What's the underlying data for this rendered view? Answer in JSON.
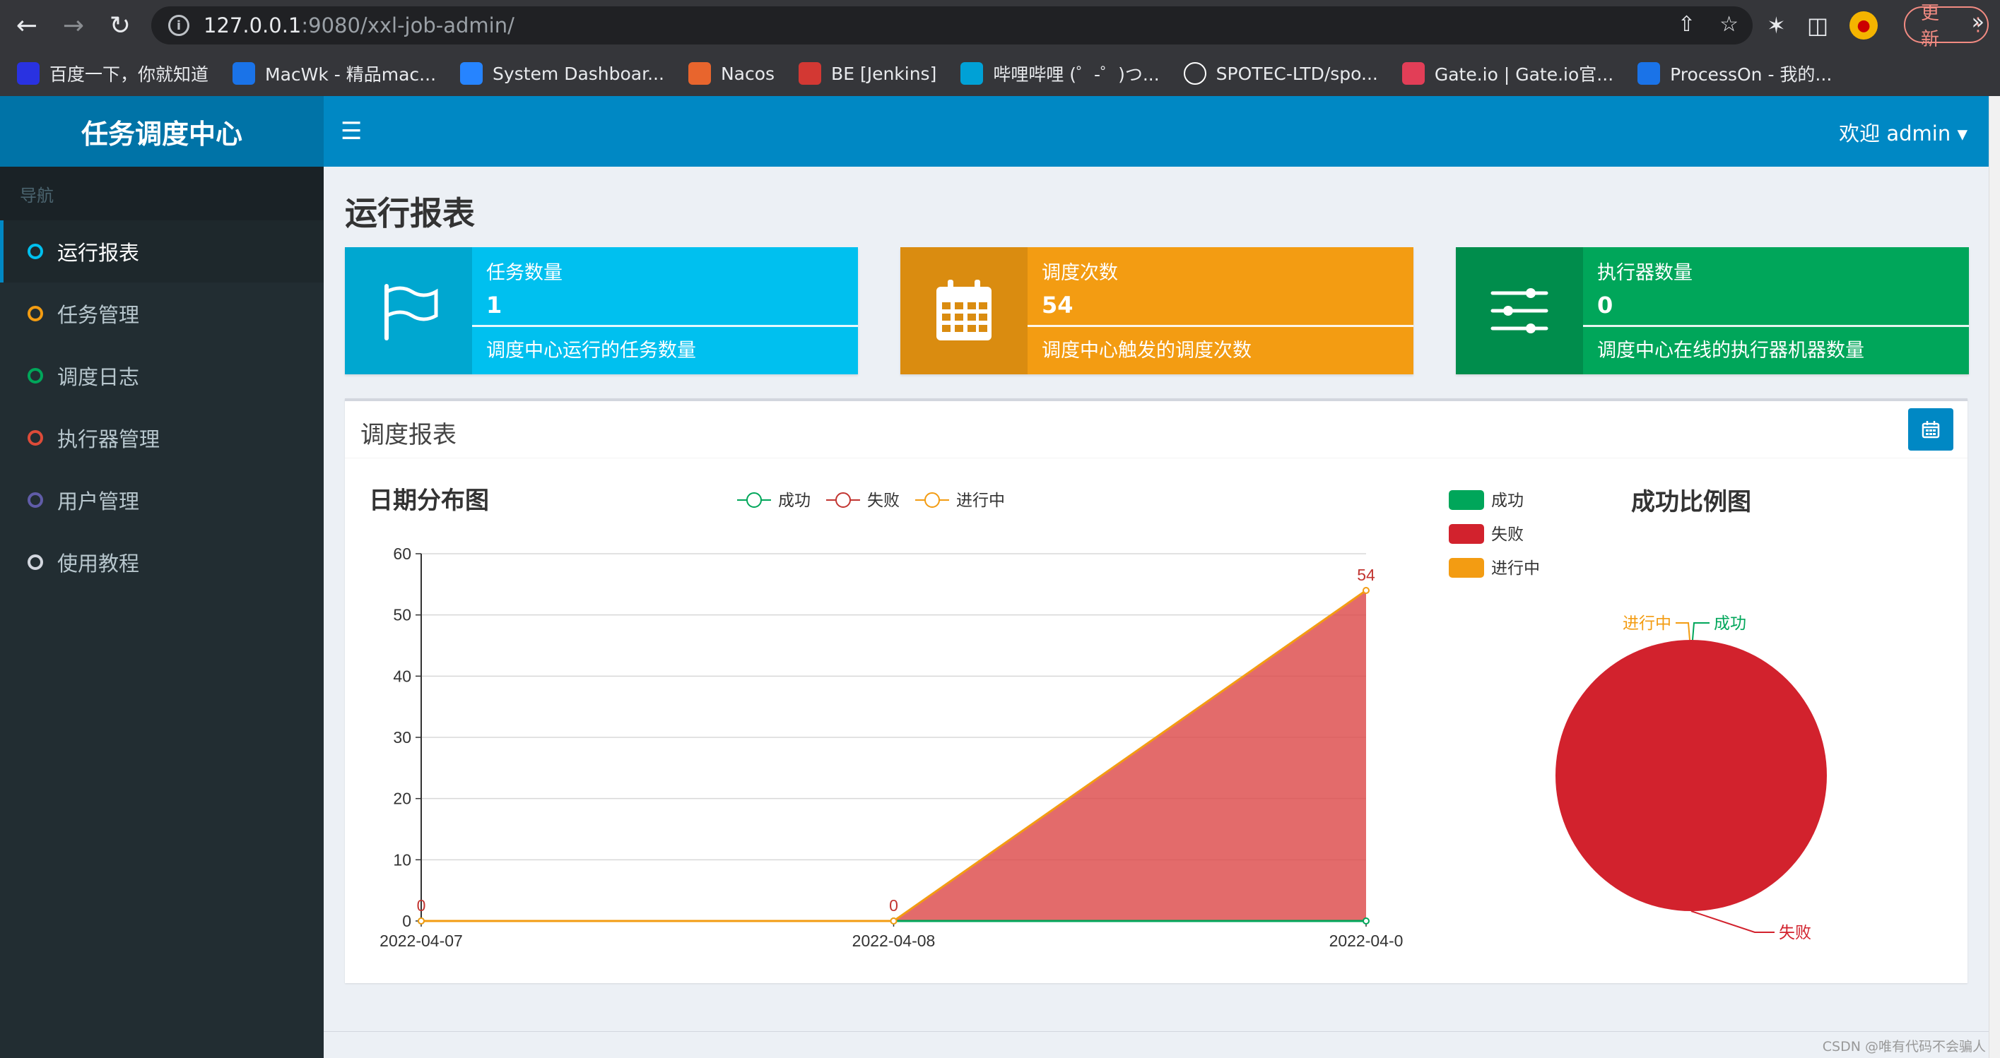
{
  "browser": {
    "url_host": "127.0.0.1",
    "url_path": ":9080/xxl-job-admin/",
    "update_label": "更新",
    "bookmarks": [
      {
        "label": "百度一下，你就知道",
        "icon": "baidu-icon",
        "color": "#2932e1"
      },
      {
        "label": "MacWk - 精品mac...",
        "icon": "macwk-icon",
        "color": "#1a73e8"
      },
      {
        "label": "System Dashboar...",
        "icon": "jira-icon",
        "color": "#2684ff"
      },
      {
        "label": "Nacos",
        "icon": "nacos-icon",
        "color": "#e8652d"
      },
      {
        "label": "BE [Jenkins]",
        "icon": "jenkins-icon",
        "color": "#d33833"
      },
      {
        "label": "哔哩哔哩 (゜-゜)つ...",
        "icon": "bilibili-icon",
        "color": "#00a1d6"
      },
      {
        "label": "SPOTEC-LTD/spo...",
        "icon": "github-icon",
        "color": "#ffffff"
      },
      {
        "label": "Gate.io | Gate.io官...",
        "icon": "gate-icon",
        "color": "#e23e57"
      },
      {
        "label": "ProcessOn - 我的...",
        "icon": "processon-icon",
        "color": "#1a73e8"
      }
    ]
  },
  "app": {
    "logo": "任务调度中心",
    "user_menu": "欢迎 admin",
    "nav_header": "导航",
    "nav_items": [
      {
        "label": "运行报表",
        "ring_color": "#00c0ef",
        "active": true
      },
      {
        "label": "任务管理",
        "ring_color": "#f39c12",
        "active": false
      },
      {
        "label": "调度日志",
        "ring_color": "#00a65a",
        "active": false
      },
      {
        "label": "执行器管理",
        "ring_color": "#dd4b39",
        "active": false
      },
      {
        "label": "用户管理",
        "ring_color": "#605ca8",
        "active": false
      },
      {
        "label": "使用教程",
        "ring_color": "#d2d6de",
        "active": false
      }
    ]
  },
  "page_title": "运行报表",
  "info_boxes": [
    {
      "label": "任务数量",
      "number": "1",
      "desc": "调度中心运行的任务数量",
      "icon": "flag-icon",
      "bg": "#00c0ef",
      "icon_bg": "#00a7d0"
    },
    {
      "label": "调度次数",
      "number": "54",
      "desc": "调度中心触发的调度次数",
      "icon": "calendar-icon",
      "bg": "#f39c12",
      "icon_bg": "#da8c10"
    },
    {
      "label": "执行器数量",
      "number": "0",
      "desc": "调度中心在线的执行器机器数量",
      "icon": "sliders-icon",
      "bg": "#00a65a",
      "icon_bg": "#008d4c"
    }
  ],
  "report_title": "调度报表",
  "chart_data": [
    {
      "type": "area",
      "title": "日期分布图",
      "categories": [
        "2022-04-07",
        "2022-04-08",
        "2022-04-0"
      ],
      "ylim": [
        0,
        60
      ],
      "yticks": [
        0,
        10,
        20,
        30,
        40,
        50,
        60
      ],
      "legend_position": "top-center",
      "grid": true,
      "series": [
        {
          "name": "成功",
          "values": [
            0,
            0,
            0
          ],
          "color": "#00a65a"
        },
        {
          "name": "失败",
          "values": [
            0,
            0,
            54
          ],
          "color": "#c23531"
        },
        {
          "name": "进行中",
          "values": [
            0,
            0,
            54
          ],
          "color": "#f39c12"
        }
      ],
      "point_labels": [
        "0",
        "0",
        "54"
      ]
    },
    {
      "type": "pie",
      "title": "成功比例图",
      "legend_position": "top-left",
      "series": [
        {
          "name": "成功",
          "value": 0,
          "color": "#00a65a"
        },
        {
          "name": "失败",
          "value": 54,
          "color": "#d2222d"
        },
        {
          "name": "进行中",
          "value": 0,
          "color": "#f39c12"
        }
      ]
    }
  ],
  "watermark": "CSDN @唯有代码不会骗人"
}
